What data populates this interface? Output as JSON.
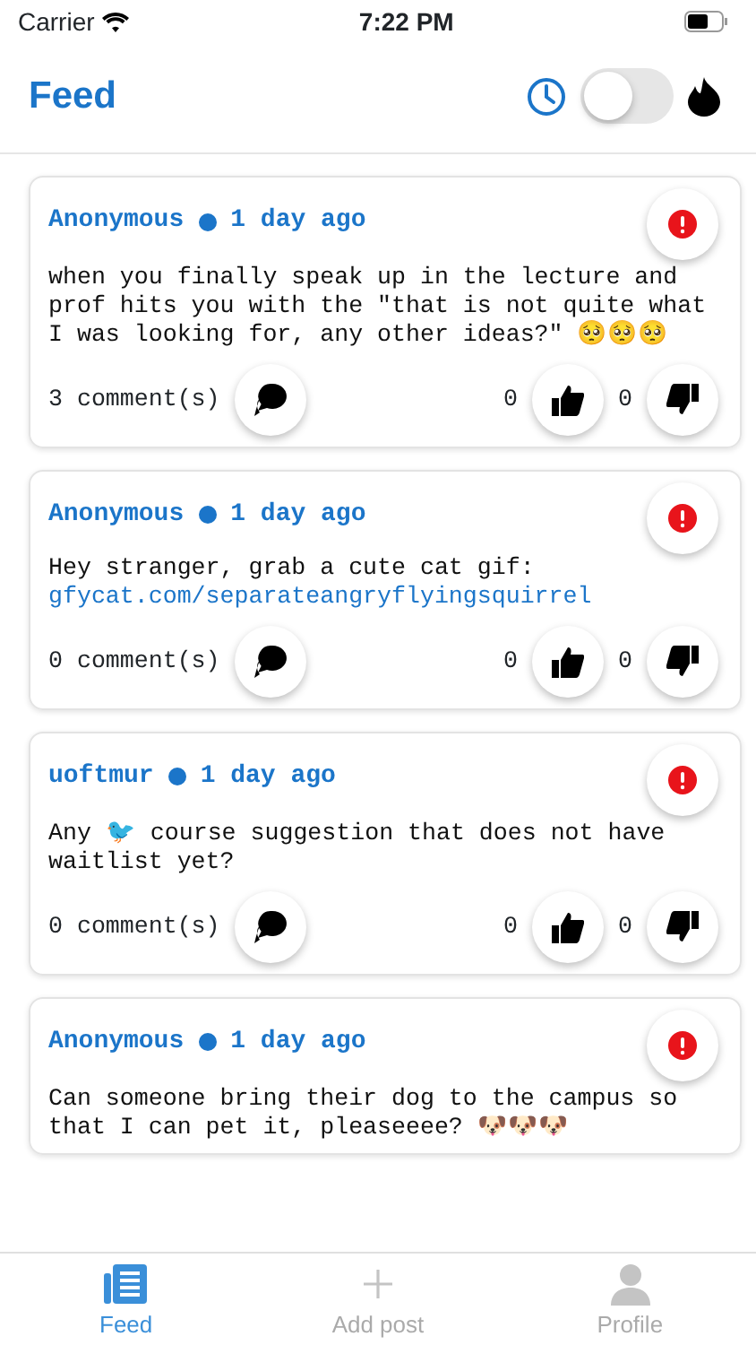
{
  "status_bar": {
    "carrier": "Carrier",
    "time": "7:22 PM"
  },
  "header": {
    "title": "Feed",
    "sort_toggle": {
      "on": false
    }
  },
  "posts": [
    {
      "author": "Anonymous",
      "time": "1 day ago",
      "body": "when you finally speak up in the lecture and prof hits you with the \"that is not quite what I was looking for, any other ideas?\" 🥺🥺🥺",
      "comments": "3 comment(s)",
      "likes": "0",
      "dislikes": "0"
    },
    {
      "author": "Anonymous",
      "time": "1 day ago",
      "body": "Hey stranger, grab a cute cat gif:",
      "link": "gfycat.com/separateangryflyingsquirrel",
      "comments": "0 comment(s)",
      "likes": "0",
      "dislikes": "0"
    },
    {
      "author": "uoftmur",
      "time": "1 day ago",
      "body": "Any 🐦 course suggestion that does not have waitlist yet?",
      "comments": "0 comment(s)",
      "likes": "0",
      "dislikes": "0"
    },
    {
      "author": "Anonymous",
      "time": "1 day ago",
      "body": "Can someone bring their dog to the campus so that I can pet it, pleaseeee? 🐶🐶🐶"
    }
  ],
  "tab_bar": [
    {
      "kind": "feed",
      "label": "Feed",
      "selected": true
    },
    {
      "kind": "add",
      "label": "Add post",
      "selected": false
    },
    {
      "kind": "profile",
      "label": "Profile",
      "selected": false
    }
  ]
}
